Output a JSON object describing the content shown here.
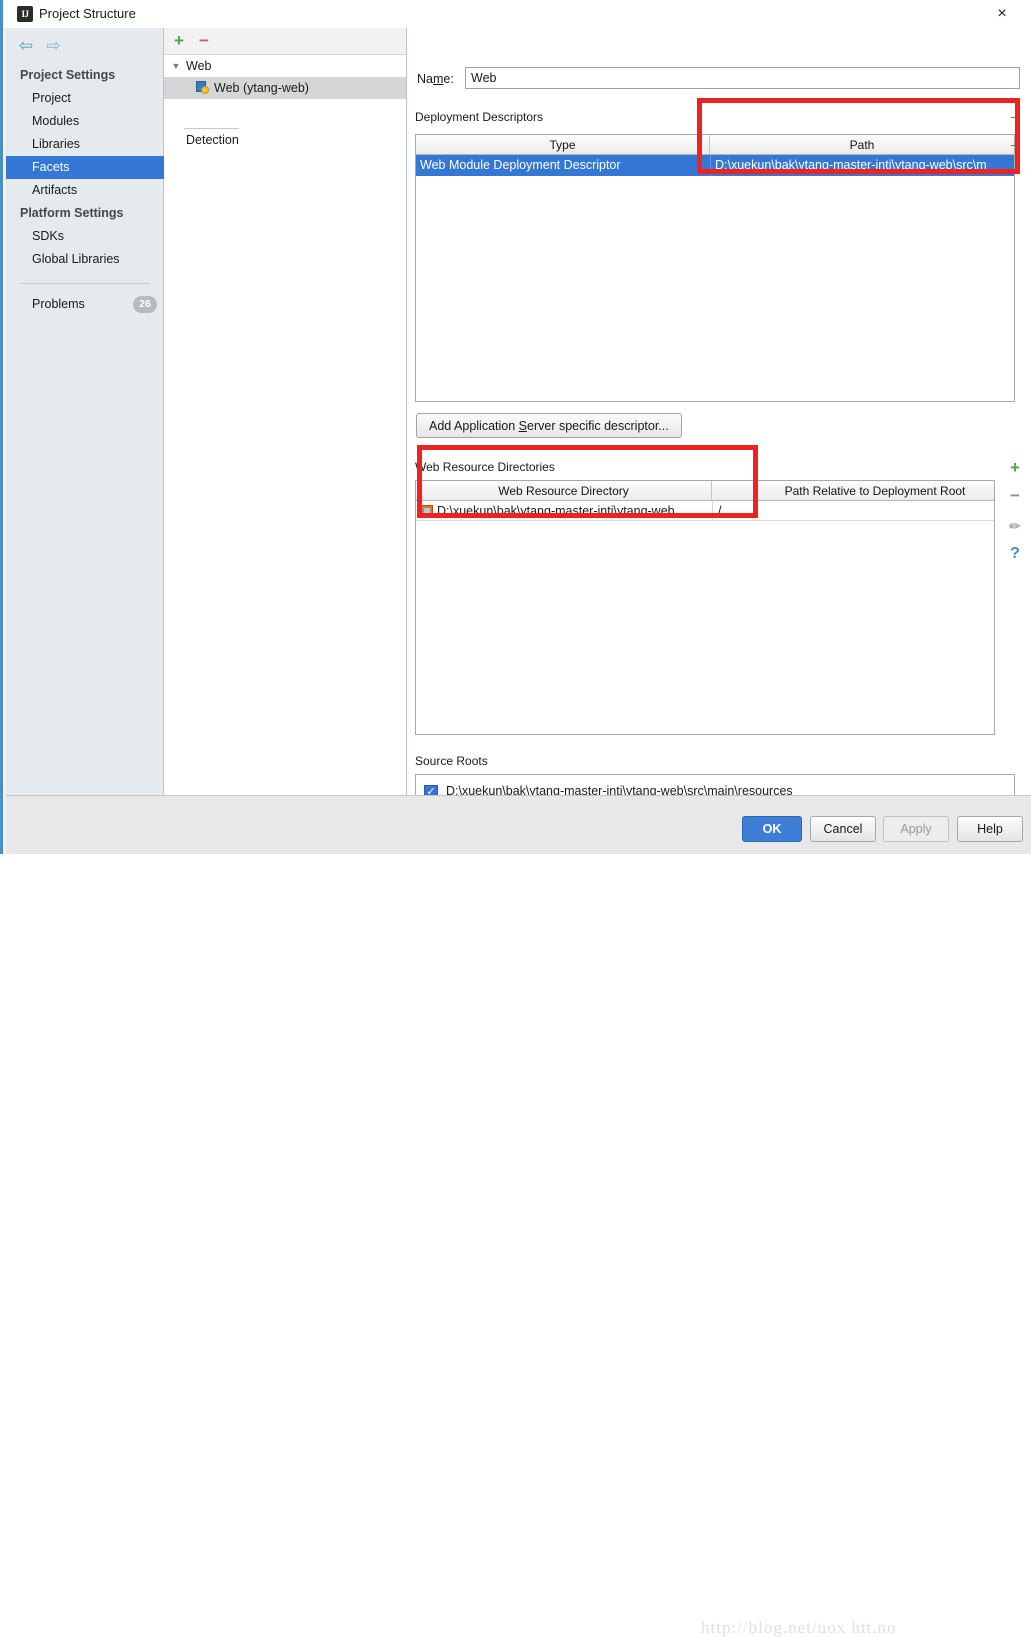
{
  "window": {
    "title": "Project Structure",
    "app_icon": "IJ",
    "close_icon": "×"
  },
  "sidebar": {
    "nav": {
      "back_icon": "⇦",
      "forward_icon": "⇨"
    },
    "groups": [
      {
        "label": "Project Settings",
        "items": [
          {
            "label": "Project",
            "selected": false
          },
          {
            "label": "Modules",
            "selected": false
          },
          {
            "label": "Libraries",
            "selected": false
          },
          {
            "label": "Facets",
            "selected": true
          },
          {
            "label": "Artifacts",
            "selected": false
          }
        ]
      },
      {
        "label": "Platform Settings",
        "items": [
          {
            "label": "SDKs",
            "selected": false
          },
          {
            "label": "Global Libraries",
            "selected": false
          }
        ]
      }
    ],
    "problems": {
      "label": "Problems",
      "count": "26"
    }
  },
  "tree_panel": {
    "toolbar": {
      "add_label": "+",
      "remove_label": "−"
    },
    "root": {
      "caret": "▼",
      "label": "Web"
    },
    "child": {
      "label": "Web (ytang-web)",
      "selected": true
    },
    "detection_label": "Detection"
  },
  "content": {
    "name_field": {
      "label_before": "Na",
      "label_mnemonic": "m",
      "label_after": "e:",
      "value": "Web",
      "placeholder": ""
    },
    "deployment_descriptors": {
      "section_label": "Deployment Descriptors",
      "columns": [
        "Type",
        "Path"
      ],
      "rows": [
        {
          "type": "Web Module Deployment Descriptor",
          "path": "D:\\xuekun\\bak\\ytang-master-intj\\ytang-web\\src\\m",
          "selected": true
        }
      ],
      "side_buttons": [
        "−",
        "−"
      ]
    },
    "add_app_server_button": {
      "text_before": "Add Application ",
      "mnemonic": "S",
      "text_after": "erver specific descriptor..."
    },
    "web_resource_directories": {
      "section_label": "Web Resource Directories",
      "columns": [
        "Web Resource Directory",
        "",
        "Path Relative to Deployment Root"
      ],
      "rows": [
        {
          "directory": "D:\\xuekun\\bak\\ytang-master-intj\\ytang-web...",
          "relative": "/"
        }
      ],
      "side_buttons": [
        {
          "name": "add",
          "glyph": "+"
        },
        {
          "name": "remove",
          "glyph": "−"
        },
        {
          "name": "edit",
          "glyph": "✏"
        },
        {
          "name": "help",
          "glyph": "?"
        }
      ]
    },
    "source_roots": {
      "section_label": "Source Roots",
      "entries": [
        {
          "checked": true,
          "check_glyph": "✓",
          "path": "D:\\xuekun\\bak\\ytang-master-intj\\ytang-web\\src\\main\\resources"
        }
      ]
    }
  },
  "footer": {
    "ok": "OK",
    "cancel": "Cancel",
    "apply": "Apply",
    "help": "Help",
    "watermark": "http://blog.net/uox htt.no"
  },
  "colors": {
    "accent_blue": "#3477d4",
    "selection_blue": "#3477d4",
    "sidebar_bg": "#e4eaee",
    "annotation_red": "#ef2222",
    "add_green": "#4aa84a",
    "remove_red": "#d05c5c",
    "help_blue": "#3a8fd0"
  }
}
